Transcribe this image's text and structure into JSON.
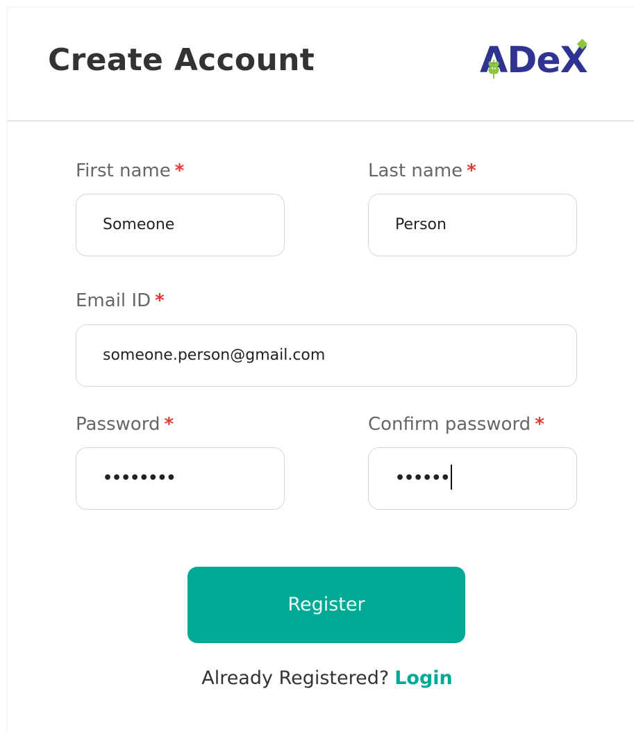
{
  "header": {
    "title": "Create Account",
    "logo_text": "ADeX"
  },
  "form": {
    "first_name": {
      "label": "First name",
      "required_mark": "*",
      "value": "Someone"
    },
    "last_name": {
      "label": "Last name",
      "required_mark": "*",
      "value": "Person"
    },
    "email": {
      "label": "Email ID",
      "required_mark": "*",
      "value": "someone.person@gmail.com"
    },
    "password": {
      "label": "Password",
      "required_mark": "*",
      "masked_value": "••••••••"
    },
    "confirm_password": {
      "label": "Confirm password",
      "required_mark": "*",
      "masked_value": "••••••"
    }
  },
  "actions": {
    "register_label": "Register",
    "already_registered_text": "Already Registered?",
    "login_label": "Login"
  },
  "colors": {
    "accent": "#00a995",
    "brand": "#2f3491",
    "brand_leaf": "#8dc63f",
    "required": "#e53935"
  },
  "icons": {
    "logo_leaf": "wheat-leaf-icon"
  }
}
